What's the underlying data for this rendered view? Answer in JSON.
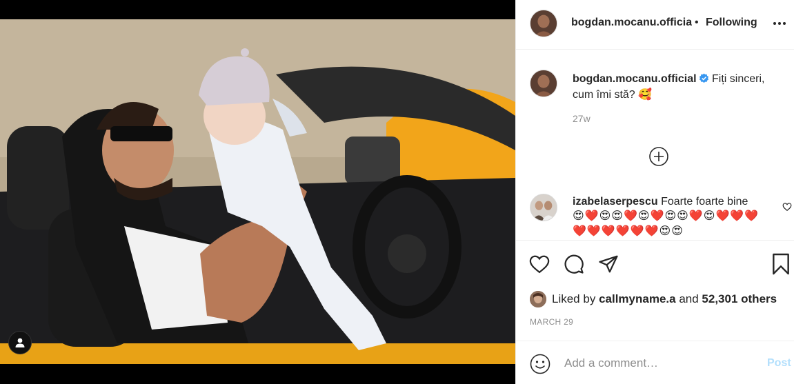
{
  "post": {
    "header": {
      "username": "bogdan.mocanu.official",
      "separator": "•",
      "follow_status": "Following",
      "more_icon": "more-horizontal-icon"
    },
    "caption": {
      "username": "bogdan.mocanu.official",
      "verified": true,
      "text": "Fiți sinceri, cum îmi stă? 🥰",
      "time": "27w"
    },
    "load_more_icon": "plus-circle-icon",
    "comments": [
      {
        "username": "izabelaserpescu",
        "text": "Foarte foarte bine",
        "emojis": "😍❤️😍😍❤️😍❤️😍😍❤️😍❤️❤️❤️❤️❤️❤️❤️❤️❤️😍😍"
      }
    ],
    "actions": {
      "like_icon": "heart-icon",
      "comment_icon": "comment-icon",
      "share_icon": "paper-plane-icon",
      "save_icon": "bookmark-icon"
    },
    "likes": {
      "prefix": "Liked by",
      "first_user": "callmyname.a",
      "middle": "and",
      "others": "52,301 others"
    },
    "date": "MARCH 29",
    "add_comment": {
      "placeholder": "Add a comment…",
      "post_label": "Post"
    }
  },
  "colors": {
    "verified_blue": "#3897f0",
    "post_button_disabled": "#b2dffc",
    "secondary_text": "#8e8e8e",
    "car_yellow": "#f2a51a"
  }
}
